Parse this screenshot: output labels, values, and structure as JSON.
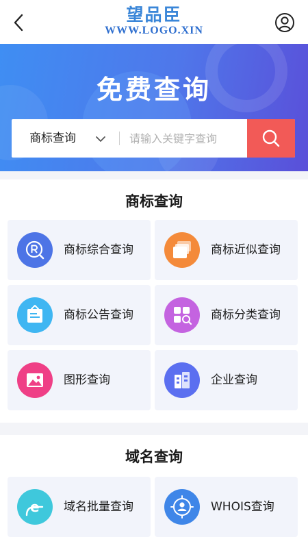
{
  "header": {
    "back_icon": "chevron-left-icon",
    "logo_cn": "望品臣",
    "logo_en": "WWW.LOGO.XIN",
    "user_icon": "user-circle-icon"
  },
  "banner": {
    "title": "免费查询",
    "search": {
      "type_label": "商标查询",
      "placeholder": "请输入关键字查询",
      "value": "",
      "button_icon": "search-icon"
    }
  },
  "sections": [
    {
      "title": "商标查询",
      "items": [
        {
          "label": "商标综合查询",
          "icon": "registered-mark-search-icon",
          "color": "#4d74e6"
        },
        {
          "label": "商标近似查询",
          "icon": "stacked-layers-icon",
          "color": "#f48a3a"
        },
        {
          "label": "商标公告查询",
          "icon": "notice-board-icon",
          "color": "#3fb6f2"
        },
        {
          "label": "商标分类查询",
          "icon": "category-grid-icon",
          "color": "#c463e0"
        },
        {
          "label": "图形查询",
          "icon": "image-icon",
          "color": "#ef3f86"
        },
        {
          "label": "企业查询",
          "icon": "building-icon",
          "color": "#5b6ff0"
        }
      ]
    },
    {
      "title": "域名查询",
      "items": [
        {
          "label": "域名批量查询",
          "icon": "domain-e-icon",
          "color": "#3fc8dc"
        },
        {
          "label": "WHOIS查询",
          "icon": "person-target-icon",
          "color": "#3f86e8"
        }
      ]
    }
  ],
  "colors": {
    "banner_start": "#3f8ef3",
    "banner_end": "#5a4fd9",
    "search_button": "#f25a57",
    "card_bg": "#f2f4fb"
  }
}
